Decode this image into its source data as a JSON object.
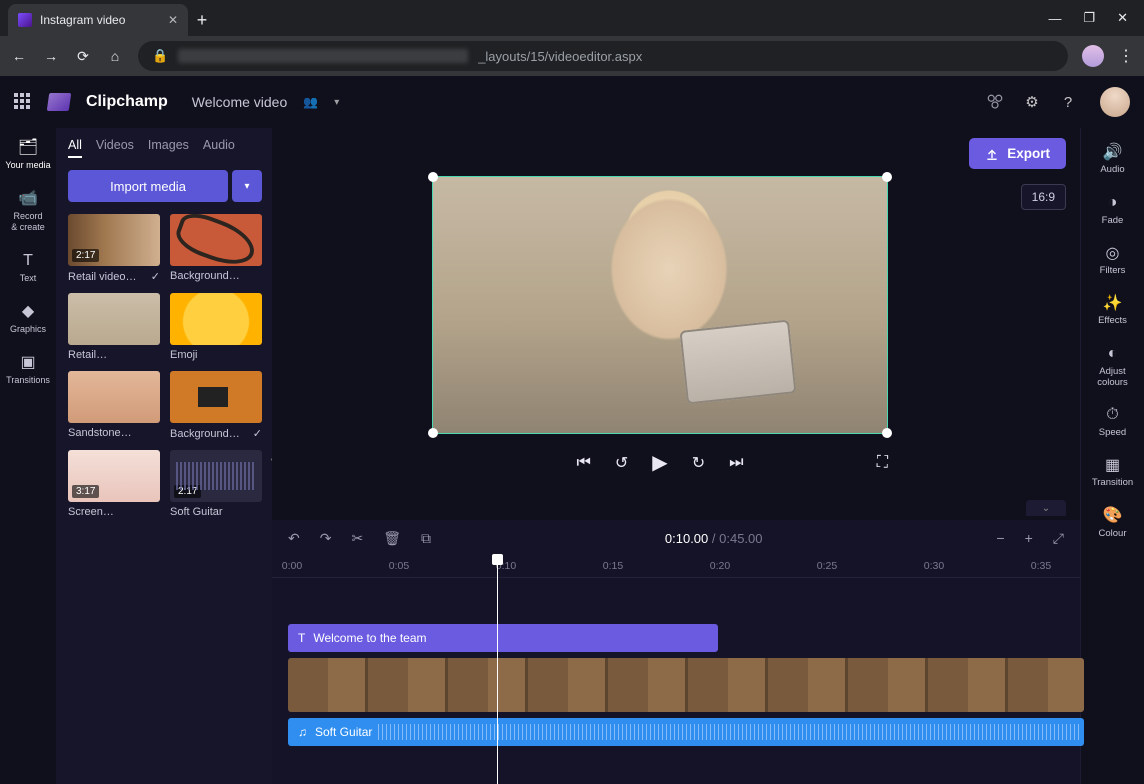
{
  "browser": {
    "tab_title": "Instagram video",
    "url_visible": "_layouts/15/videoeditor.aspx"
  },
  "header": {
    "brand": "Clipchamp",
    "project_name": "Welcome video"
  },
  "export_label": "Export",
  "aspect_label": "16:9",
  "left_rail": [
    {
      "label": "Your media"
    },
    {
      "label": "Record\n& create"
    },
    {
      "label": "Text"
    },
    {
      "label": "Graphics"
    },
    {
      "label": "Transitions"
    }
  ],
  "media_tabs": [
    "All",
    "Videos",
    "Images",
    "Audio"
  ],
  "import_label": "Import media",
  "media": [
    {
      "label": "Retail video…",
      "dur": "2:17",
      "check": true,
      "thumb": "t1"
    },
    {
      "label": "Background…",
      "dur": "",
      "check": false,
      "thumb": "t2"
    },
    {
      "label": "Retail…",
      "dur": "",
      "check": false,
      "thumb": "t3"
    },
    {
      "label": "Emoji",
      "dur": "",
      "check": false,
      "thumb": "t4"
    },
    {
      "label": "Sandstone…",
      "dur": "",
      "check": false,
      "thumb": "t5"
    },
    {
      "label": "Background…",
      "dur": "",
      "check": true,
      "thumb": "t6"
    },
    {
      "label": "Screen…",
      "dur": "3:17",
      "check": false,
      "thumb": "t7"
    },
    {
      "label": "Soft Guitar",
      "dur": "2:17",
      "check": false,
      "thumb": "t8"
    }
  ],
  "timecode": {
    "current": "0:10.00",
    "total": "0:45.00"
  },
  "ruler": [
    "0:00",
    "0:05",
    "0:10",
    "0:15",
    "0:20",
    "0:25",
    "0:30",
    "0:35"
  ],
  "tracks": {
    "text_label": "Welcome to the team",
    "audio_label": "Soft Guitar"
  },
  "right_rail": [
    {
      "label": "Audio"
    },
    {
      "label": "Fade"
    },
    {
      "label": "Filters"
    },
    {
      "label": "Effects"
    },
    {
      "label": "Adjust\ncolours"
    },
    {
      "label": "Speed"
    },
    {
      "label": "Transition"
    },
    {
      "label": "Colour"
    }
  ]
}
